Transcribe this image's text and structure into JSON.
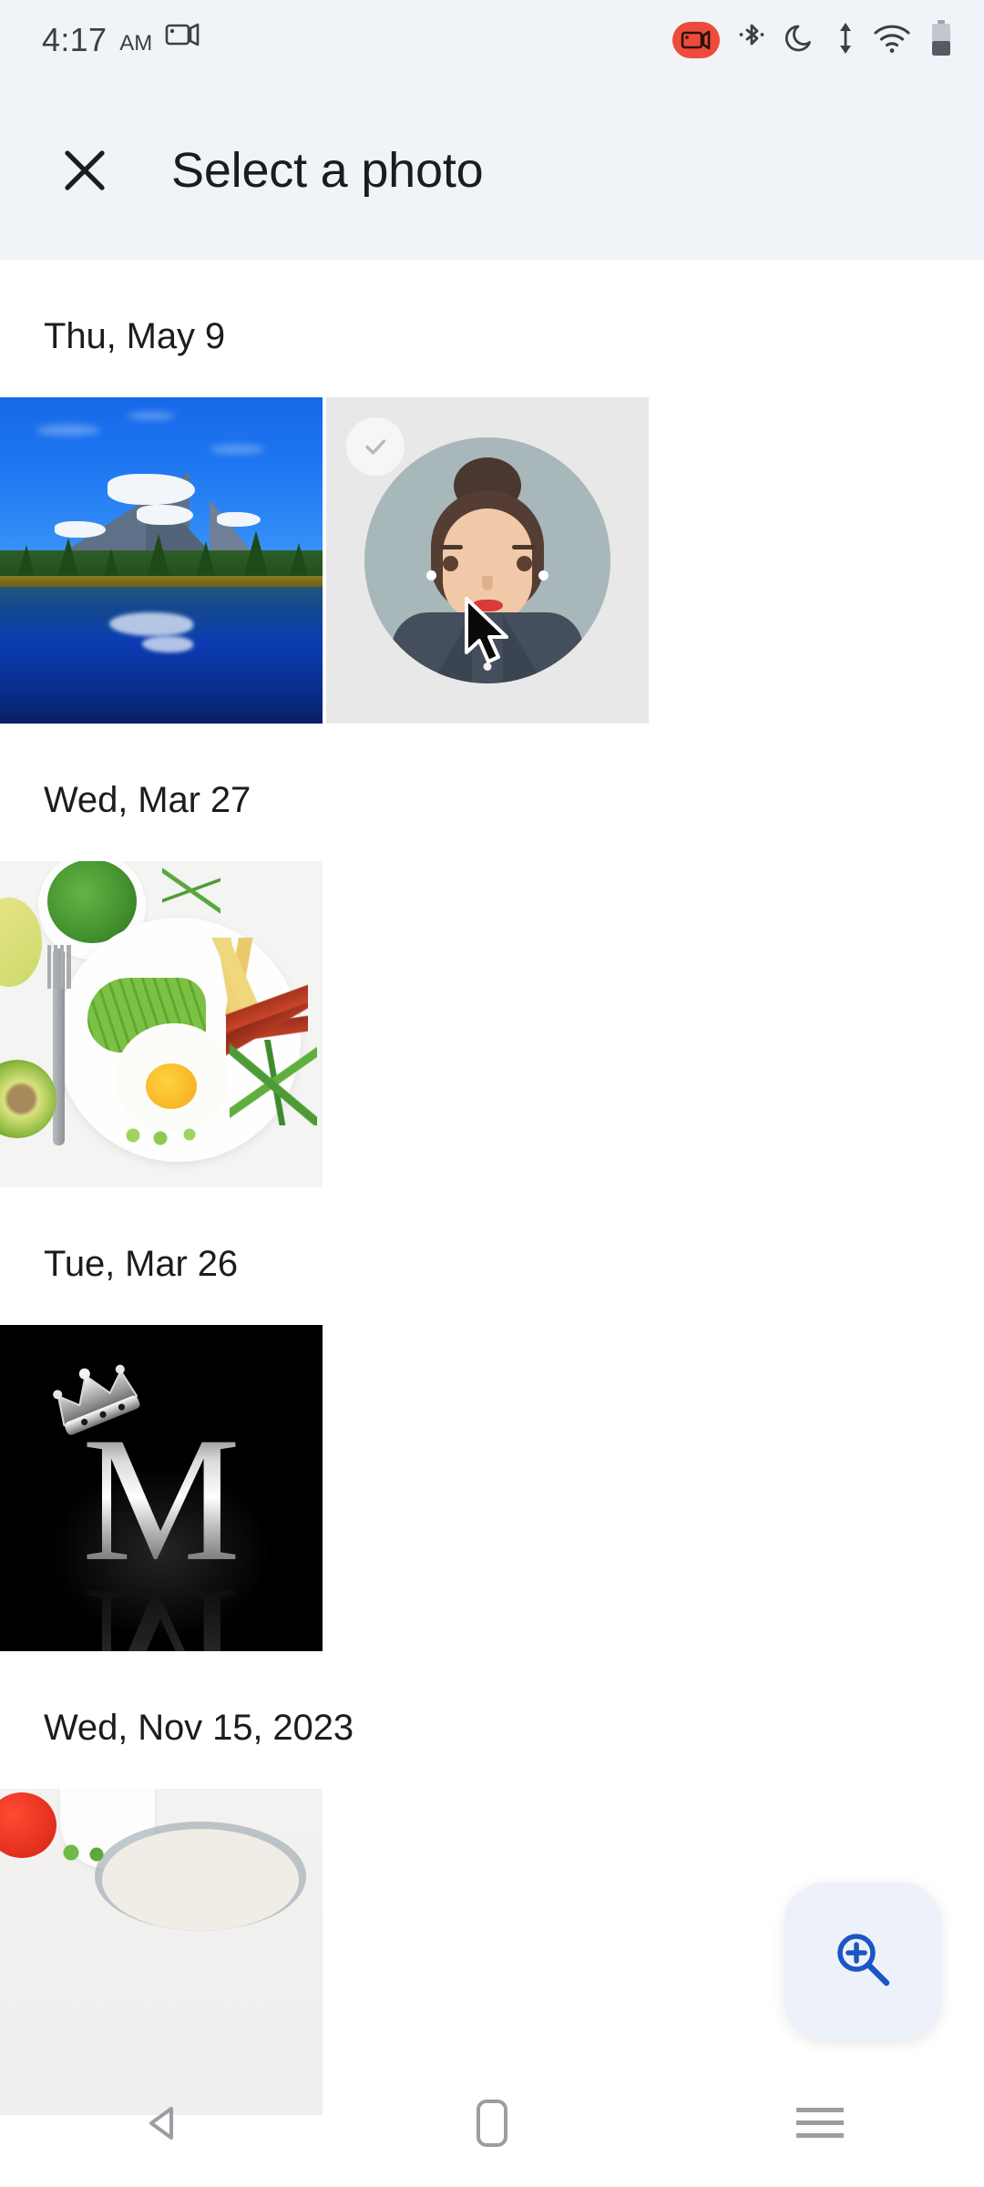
{
  "status_bar": {
    "time": "4:17",
    "am_pm": "AM",
    "icons": [
      {
        "name": "screen-cast-icon",
        "label": "screen-cast"
      },
      {
        "name": "screen-record-icon",
        "label": "screen-record"
      },
      {
        "name": "bluetooth-icon",
        "label": "bluetooth"
      },
      {
        "name": "do-not-disturb-icon",
        "label": "do-not-disturb-moon"
      },
      {
        "name": "data-transfer-icon",
        "label": "data-transfer"
      },
      {
        "name": "wifi-icon",
        "label": "wifi"
      },
      {
        "name": "battery-icon",
        "label": "battery"
      }
    ]
  },
  "app_bar": {
    "close_label": "×",
    "title": "Select a photo",
    "background": "#F0F3F8"
  },
  "sections": [
    {
      "date": "Thu, May 9",
      "photos": [
        {
          "name": "photo-mountain-lake",
          "alt": "Mountain lake reflection",
          "selected": false,
          "badge": false
        },
        {
          "name": "photo-avatar-woman",
          "alt": "Illustrated woman avatar",
          "selected": false,
          "badge": true
        }
      ]
    },
    {
      "date": "Wed, Mar 27",
      "photos": [
        {
          "name": "photo-breakfast-plate",
          "alt": "Breakfast plate with egg avocado bacon",
          "selected": false,
          "badge": false
        }
      ]
    },
    {
      "date": "Tue, Mar 26",
      "photos": [
        {
          "name": "photo-crowned-m",
          "alt": "Silver letter M with crown on black",
          "selected": false,
          "badge": false
        }
      ]
    },
    {
      "date": "Wed, Nov 15, 2023",
      "photos": [
        {
          "name": "photo-food-partial",
          "alt": "Partially visible food photo",
          "selected": false,
          "badge": false
        }
      ]
    }
  ],
  "fab": {
    "name": "zoom-in-fab",
    "icon": "magnifier-plus-icon",
    "accent": "#1A56C4",
    "background": "#EDF1F9"
  },
  "cursor": {
    "name": "mouse-cursor",
    "on_photo": "photo-avatar-woman"
  },
  "nav_bar": {
    "back_label": "back",
    "home_label": "home",
    "recents_label": "recents"
  },
  "colors": {
    "app_bar_bg": "#F0F3F8",
    "page_bg": "#FFFFFF",
    "text_primary": "#1B1C1E",
    "status_text": "#3B3F45",
    "record_badge": "#EE4B3C",
    "nav_icon": "#9A9EA3"
  }
}
